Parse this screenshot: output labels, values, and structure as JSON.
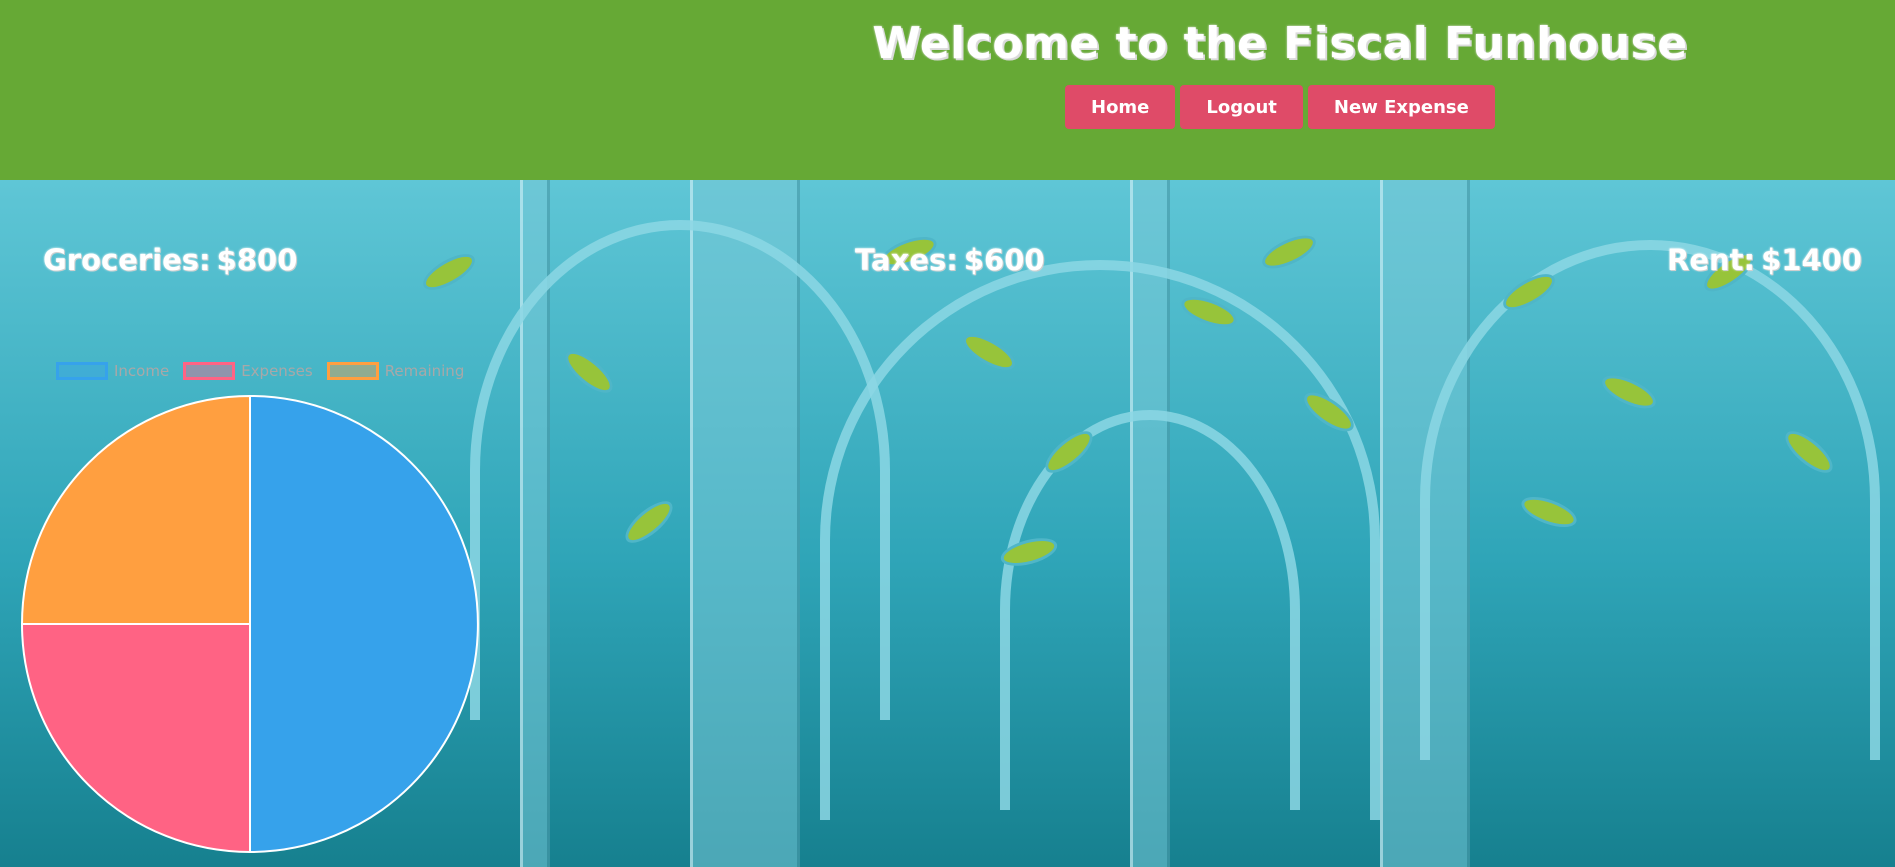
{
  "header": {
    "title": "Welcome to the Fiscal Funhouse",
    "nav": [
      "Home",
      "Logout",
      "New Expense"
    ]
  },
  "expenses": [
    {
      "label": "Groceries:",
      "amount": "$800"
    },
    {
      "label": "Taxes:",
      "amount": "$600"
    },
    {
      "label": "Rent:",
      "amount": "$1400"
    }
  ],
  "colors": {
    "header_bg": "#66a935",
    "button_bg": "#df4b68",
    "income": "#36a2eb",
    "expenses": "#ff6384",
    "remaining": "#ff9f40"
  },
  "chart_data": {
    "type": "pie",
    "categories": [
      "Income",
      "Expenses",
      "Remaining"
    ],
    "values": [
      50,
      25,
      25
    ],
    "colors": [
      "#36a2eb",
      "#ff6384",
      "#ff9f40"
    ],
    "legend": "top"
  }
}
